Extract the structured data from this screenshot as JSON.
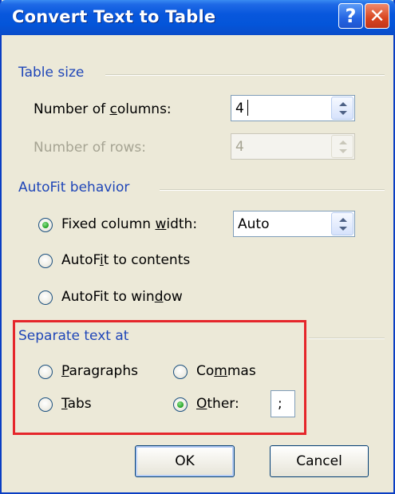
{
  "dialog": {
    "title": "Convert Text to Table",
    "help_glyph": "?",
    "close_glyph": "✕"
  },
  "table_size": {
    "heading": "Table size",
    "columns_label_pre": "Number of ",
    "columns_label_u": "c",
    "columns_label_post": "olumns:",
    "columns_value": "4",
    "rows_label": "Number of rows:",
    "rows_value": "4",
    "rows_enabled": false
  },
  "autofit": {
    "heading": "AutoFit behavior",
    "fixed_pre": "Fixed column ",
    "fixed_u": "w",
    "fixed_post": "idth:",
    "fixed_value": "Auto",
    "contents_pre": "AutoF",
    "contents_u": "i",
    "contents_post": "t to contents",
    "window_pre": "AutoFit to win",
    "window_u": "d",
    "window_post": "ow",
    "selected": "fixed"
  },
  "separate": {
    "heading": "Separate text at",
    "paragraphs_u": "P",
    "paragraphs_post": "aragraphs",
    "commas_pre": "Co",
    "commas_u": "m",
    "commas_post": "mas",
    "tabs_u": "T",
    "tabs_post": "abs",
    "other_u": "O",
    "other_post": "ther:",
    "other_value": ";",
    "selected": "other",
    "highlight_color": "#e5262b"
  },
  "buttons": {
    "ok": "OK",
    "cancel": "Cancel"
  },
  "colors": {
    "titlebar": "#0455d9",
    "group_heading": "#1f46b8",
    "dialog_bg": "#ece9d8"
  },
  "icons": [
    "help-icon",
    "close-icon",
    "spin-up-arrow-icon",
    "spin-down-arrow-icon"
  ]
}
